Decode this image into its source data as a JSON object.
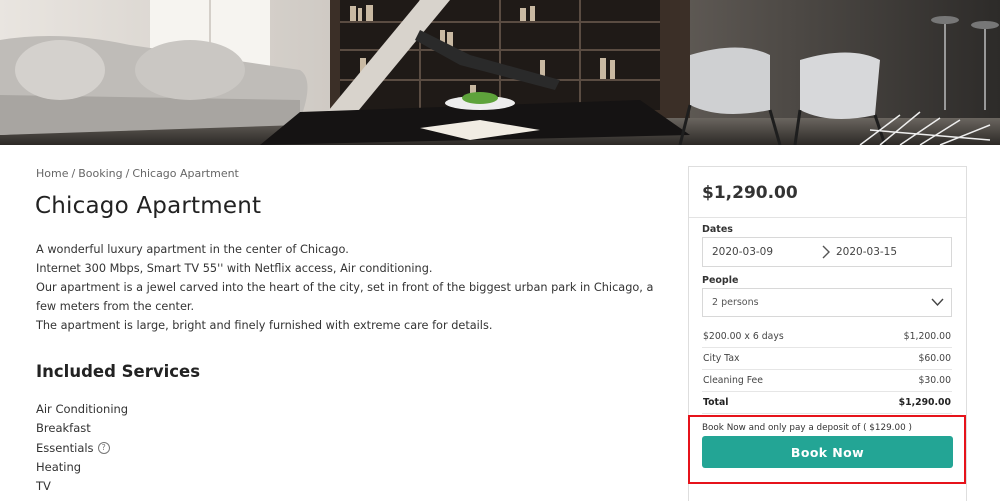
{
  "breadcrumb": {
    "home": "Home",
    "booking": "Booking",
    "current": "Chicago Apartment",
    "separator": "/"
  },
  "page_title": "Chicago Apartment",
  "description": [
    "A wonderful luxury apartment in the center of Chicago.",
    "Internet 300 Mbps, Smart TV 55'' with Netflix access, Air conditioning.",
    "Our apartment is a jewel carved into the heart of the city, set in front of the biggest urban park in Chicago, a few meters from the center.",
    "The apartment is large, bright and finely furnished with extreme care for details."
  ],
  "services": {
    "title": "Included Services",
    "items": [
      "Air Conditioning",
      "Breakfast",
      "Essentials",
      "Heating",
      "TV"
    ],
    "help_icon": "?"
  },
  "booking": {
    "price": "$1,290.00",
    "dates_label": "Dates",
    "date_start": "2020-03-09",
    "date_end": "2020-03-15",
    "people_label": "People",
    "people_value": "2 persons",
    "breakdown": [
      {
        "label": "$200.00 x 6 days",
        "amount": "$1,200.00"
      },
      {
        "label": "City Tax",
        "amount": "$60.00"
      },
      {
        "label": "Cleaning Fee",
        "amount": "$30.00"
      }
    ],
    "total_label": "Total",
    "total_amount": "$1,290.00",
    "deposit_text": "Book Now and only pay a deposit of ( $129.00 )",
    "book_button": "Book Now"
  },
  "colors": {
    "accent": "#23a595",
    "highlight": "#e6131b"
  },
  "icons": {
    "date_separator": "chevron-right-icon",
    "people_dropdown": "chevron-down-icon",
    "help": "help-circle-icon"
  }
}
